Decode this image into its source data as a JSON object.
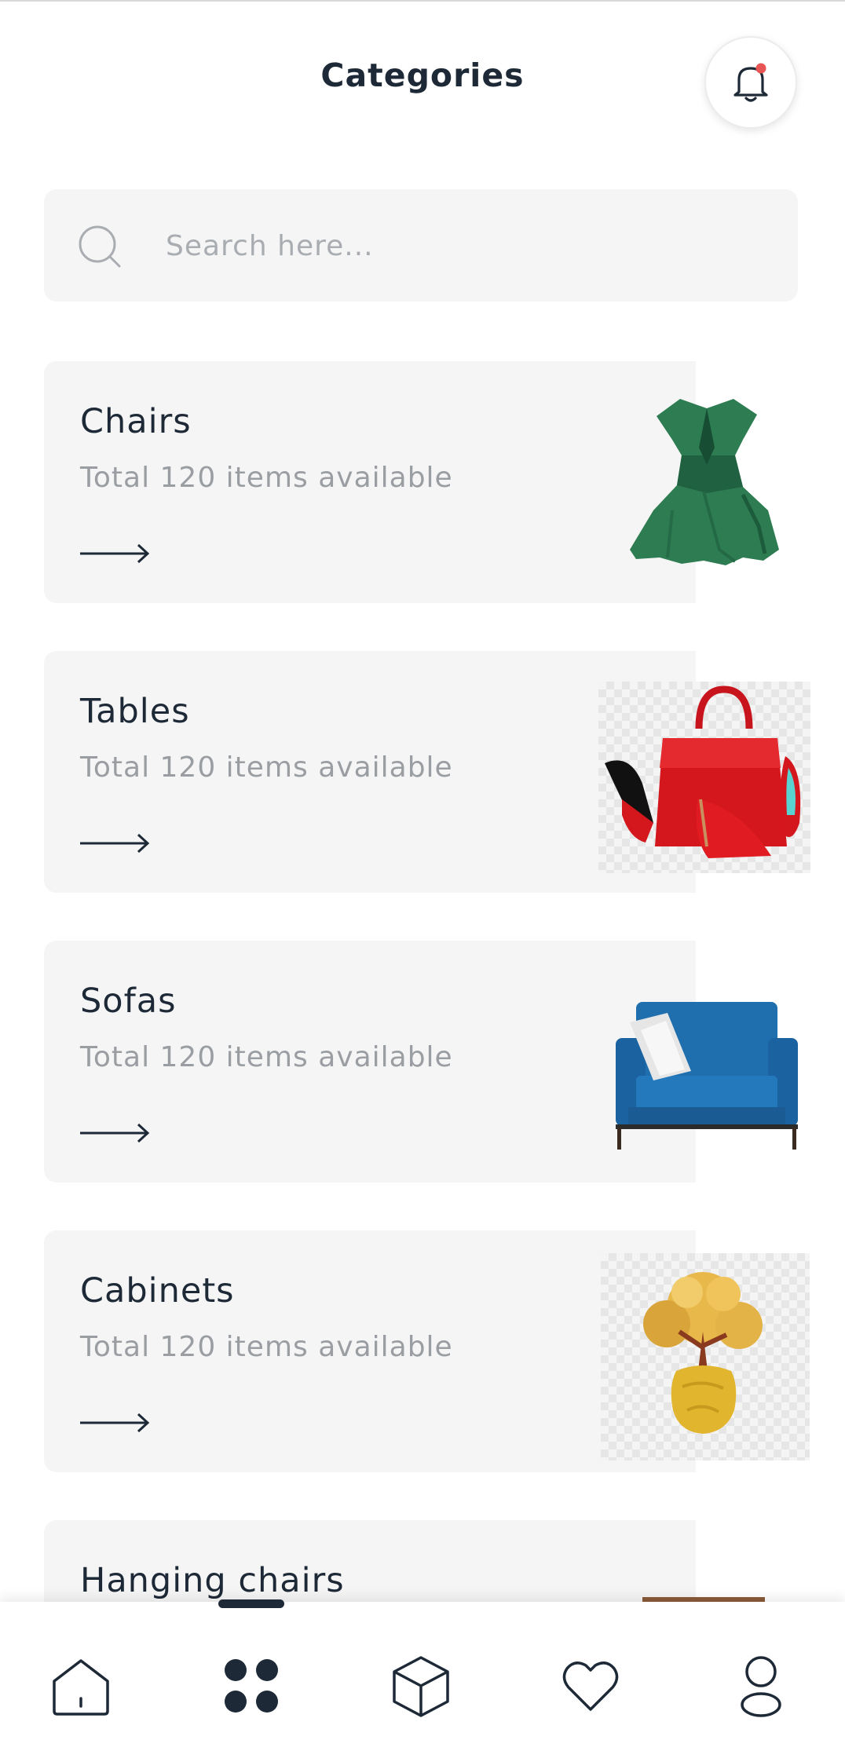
{
  "header": {
    "title": "Categories",
    "notification_icon": "bell-icon",
    "notification_dot_color": "#e85555"
  },
  "search": {
    "placeholder": "Search here...",
    "value": "",
    "icon": "search-icon"
  },
  "categories": [
    {
      "title": "Chairs",
      "subtitle": "Total 120 items available",
      "image": "green-dress-image"
    },
    {
      "title": "Tables",
      "subtitle": "Total 120 items available",
      "image": "red-handbag-shoes-image"
    },
    {
      "title": "Sofas",
      "subtitle": "Total 120 items available",
      "image": "blue-armchair-image"
    },
    {
      "title": "Cabinets",
      "subtitle": "Total 120 items available",
      "image": "gold-bonsai-tree-image"
    },
    {
      "title": "Hanging chairs",
      "subtitle": "",
      "image": "hanging-chair-image"
    }
  ],
  "bottom_nav": {
    "items": [
      "home-icon",
      "categories-grid-icon",
      "box-icon",
      "heart-icon",
      "profile-icon"
    ],
    "active": "categories-grid-icon"
  },
  "colors": {
    "primary": "#1d2936",
    "card_bg": "#f5f5f5",
    "muted_text": "#9a9ea3"
  }
}
